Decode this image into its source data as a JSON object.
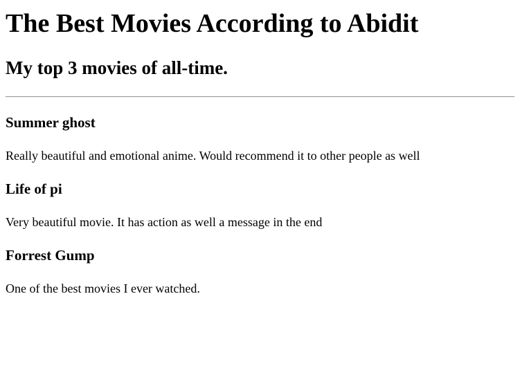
{
  "page": {
    "title": "The Best Movies According to Abidit",
    "subtitle": "My top 3 movies of all-time."
  },
  "movies": [
    {
      "title": "Summer ghost",
      "description": "Really beautiful and emotional anime. Would recommend it to other people as well"
    },
    {
      "title": "Life of pi",
      "description": "Very beautiful movie. It has action as well a message in the end"
    },
    {
      "title": "Forrest Gump",
      "description": "One of the best movies I ever watched."
    }
  ]
}
